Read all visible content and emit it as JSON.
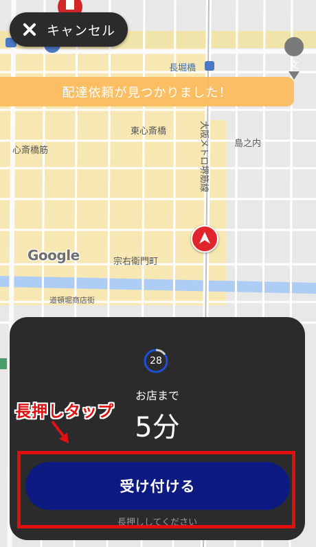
{
  "cancel": {
    "label": "キャンセル",
    "icon": "close-icon"
  },
  "banner": {
    "text": "配達依頼が見つかりました！"
  },
  "map": {
    "labels": {
      "nagahoribashi": "長堀橋",
      "higashi_shinsaibashi": "東心斎橋",
      "shinsaibashi_suji": "心斎橋筋",
      "sakaisuji_line": "大阪メトロ堺筋線",
      "shimanouchi": "島之内",
      "soemon_cho": "宗右衛門町",
      "dotonbori_shotengai": "道頓堀商店街"
    },
    "google_logo": "Google",
    "school_icon_glyph": "文"
  },
  "panel": {
    "timer": "28",
    "timer_progress": 0.15,
    "to_store": "お店まで",
    "eta": "5分",
    "accept_label": "受け付ける",
    "hint": "長押ししてください"
  },
  "annotation": {
    "text": "長押しタップ"
  },
  "colors": {
    "accent_orange": "#fbba5c",
    "accept_blue": "#0c1a82",
    "panel_dark": "#2b2b2b",
    "annotation_red": "#e01010",
    "marker_red": "#e0262c"
  }
}
